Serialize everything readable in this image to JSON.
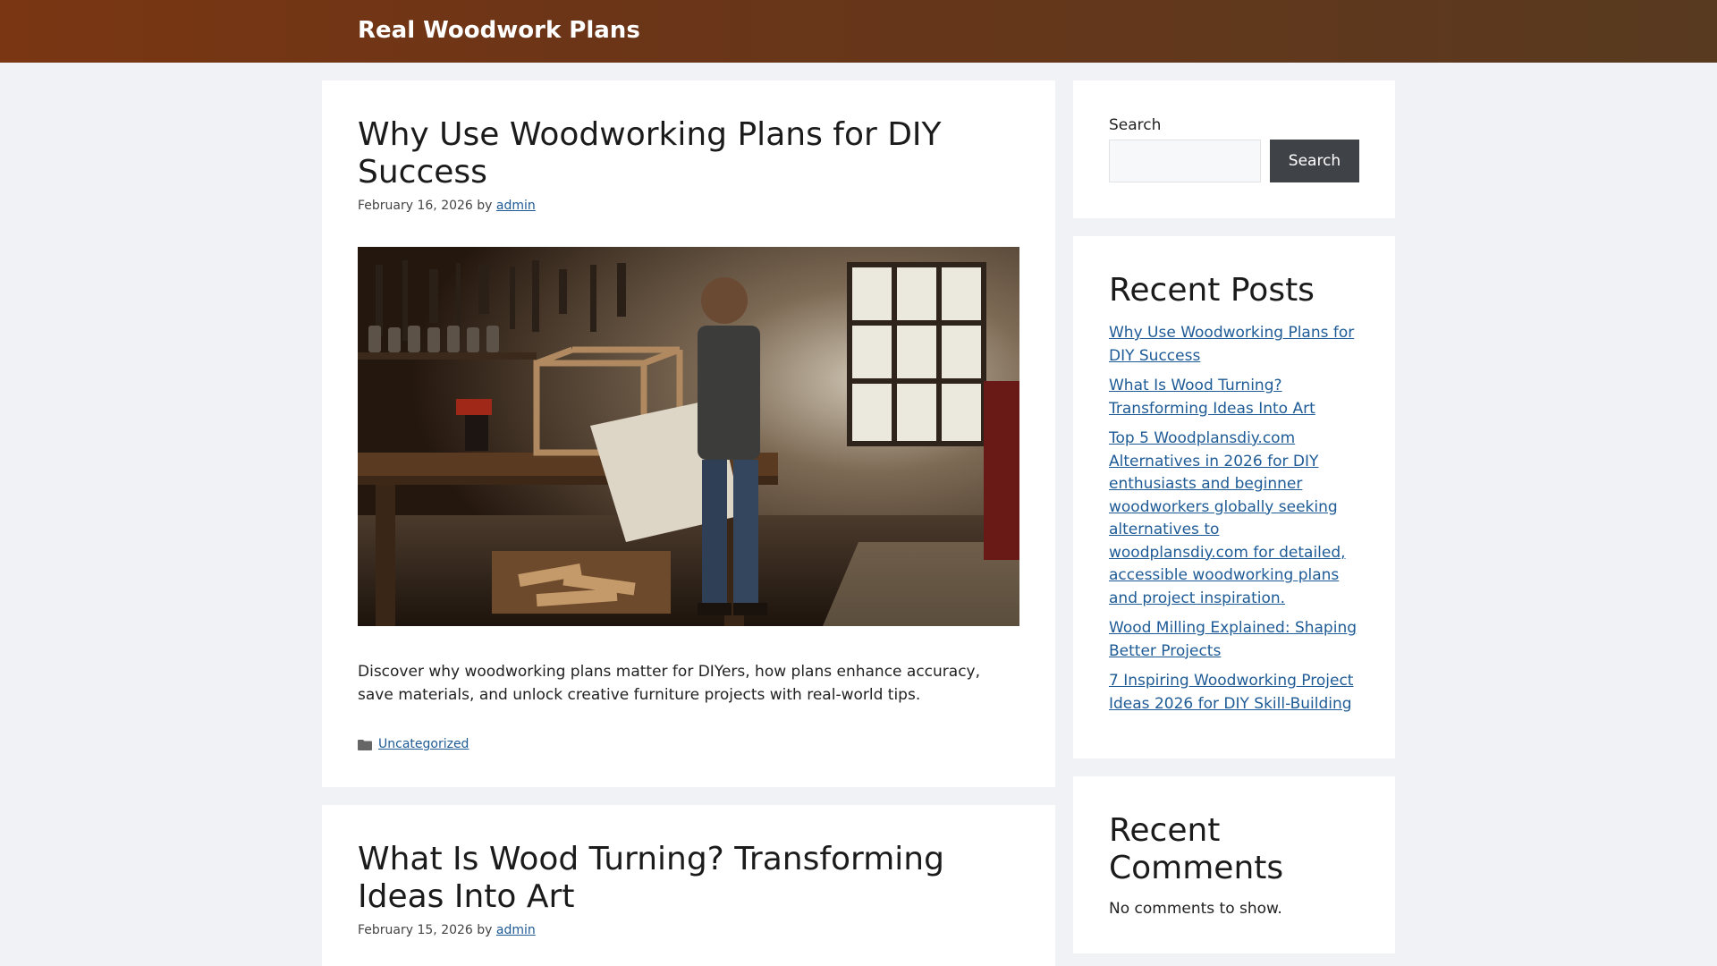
{
  "site": {
    "title": "Real Woodwork Plans"
  },
  "posts": [
    {
      "title": "Why Use Woodworking Plans for DIY Success",
      "date": "February 16, 2026",
      "by": "by",
      "author": "admin",
      "image_alt": "woodworker-reading-plans-in-workshop",
      "excerpt": "Discover why woodworking plans matter for DIYers, how plans enhance accuracy, save materials, and unlock creative furniture projects with real-world tips.",
      "category": "Uncategorized"
    },
    {
      "title": "What Is Wood Turning? Transforming Ideas Into Art",
      "date": "February 15, 2026",
      "by": "by",
      "author": "admin"
    }
  ],
  "sidebar": {
    "search": {
      "label": "Search",
      "placeholder": "",
      "button_label": "Search"
    },
    "recent_posts": {
      "title": "Recent Posts",
      "items": [
        "Why Use Woodworking Plans for DIY Success",
        "What Is Wood Turning? Transforming Ideas Into Art",
        "Top 5 Woodplansdiy.com Alternatives in 2026 for DIY enthusiasts and beginner woodworkers globally seeking alternatives to woodplansdiy.com for detailed, accessible woodworking plans and project inspiration.",
        "Wood Milling Explained: Shaping Better Projects",
        "7 Inspiring Woodworking Project Ideas 2026 for DIY Skill-Building"
      ]
    },
    "recent_comments": {
      "title": "Recent Comments",
      "empty": "No comments to show."
    }
  },
  "colors": {
    "header_start": "#7a3613",
    "header_end": "#583a20",
    "link": "#1e5b96",
    "button": "#3f4247",
    "background": "#f0f2f5"
  }
}
